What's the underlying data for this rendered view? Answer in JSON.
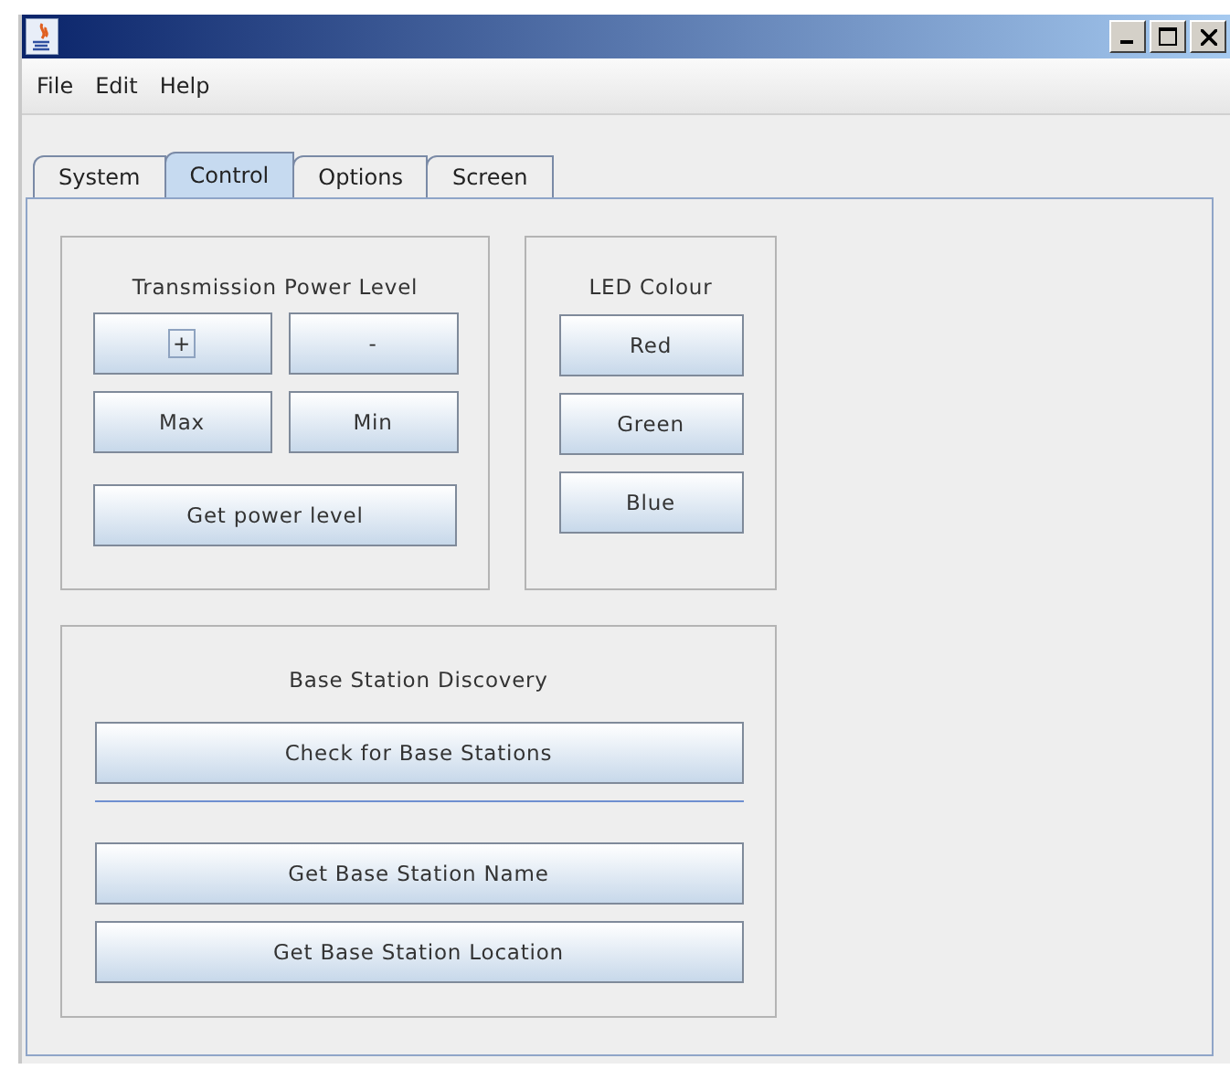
{
  "menu": [
    "File",
    "Edit",
    "Help"
  ],
  "tabs": [
    {
      "label": "System",
      "selected": false
    },
    {
      "label": "Control",
      "selected": true
    },
    {
      "label": "Options",
      "selected": false
    },
    {
      "label": "Screen",
      "selected": false
    }
  ],
  "power_panel": {
    "title": "Transmission Power Level",
    "buttons": [
      {
        "label": "+",
        "focused": true
      },
      {
        "label": "-",
        "focused": false
      },
      {
        "label": "Max",
        "focused": false
      },
      {
        "label": "Min",
        "focused": false
      }
    ],
    "wide_button": "Get power level"
  },
  "led_panel": {
    "title": "LED Colour",
    "buttons": [
      "Red",
      "Green",
      "Blue"
    ]
  },
  "discovery_panel": {
    "title": "Base Station Discovery",
    "buttons": [
      "Check for Base Stations",
      "Get Base Station Name",
      "Get Base Station Location"
    ]
  }
}
